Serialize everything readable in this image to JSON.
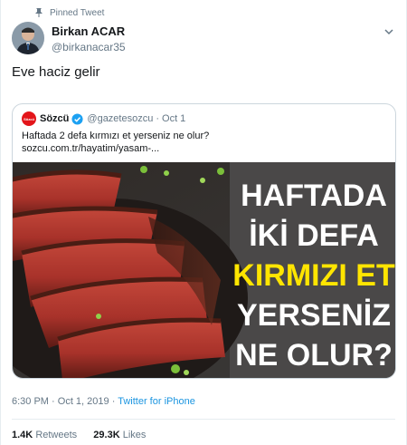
{
  "pinned_label": "Pinned Tweet",
  "author": {
    "name": "Birkan ACAR",
    "handle": "@birkanacar35"
  },
  "tweet_text": "Eve haciz gelir",
  "quote": {
    "logo_text": "Sözcü",
    "name": "Sözcü",
    "handle": "@gazetesozcu",
    "separator": "·",
    "date": "Oct 1",
    "text_line1": "Haftada 2 defa kırmızı et yerseniz ne olur?",
    "text_line2": "sozcu.com.tr/hayatim/yasam-...",
    "image_headline": [
      "HAFTADA",
      "İKİ DEFA",
      "KIRMIZI ET",
      "YERSENİZ",
      "NE OLUR?"
    ]
  },
  "meta": {
    "time": "6:30 PM",
    "separator": "·",
    "date": "Oct 1, 2019",
    "via": "Twitter for iPhone"
  },
  "stats": {
    "retweets_count": "1.4K",
    "retweets_label": "Retweets",
    "likes_count": "29.3K",
    "likes_label": "Likes"
  },
  "colors": {
    "accent": "#1b95e0",
    "verified": "#1da1f2",
    "sozcu_red": "#e3151a",
    "headline_yellow": "#ffe500",
    "muted": "#657786"
  },
  "icons": [
    "pin-icon",
    "chevron-down-icon",
    "verified-badge-icon"
  ]
}
